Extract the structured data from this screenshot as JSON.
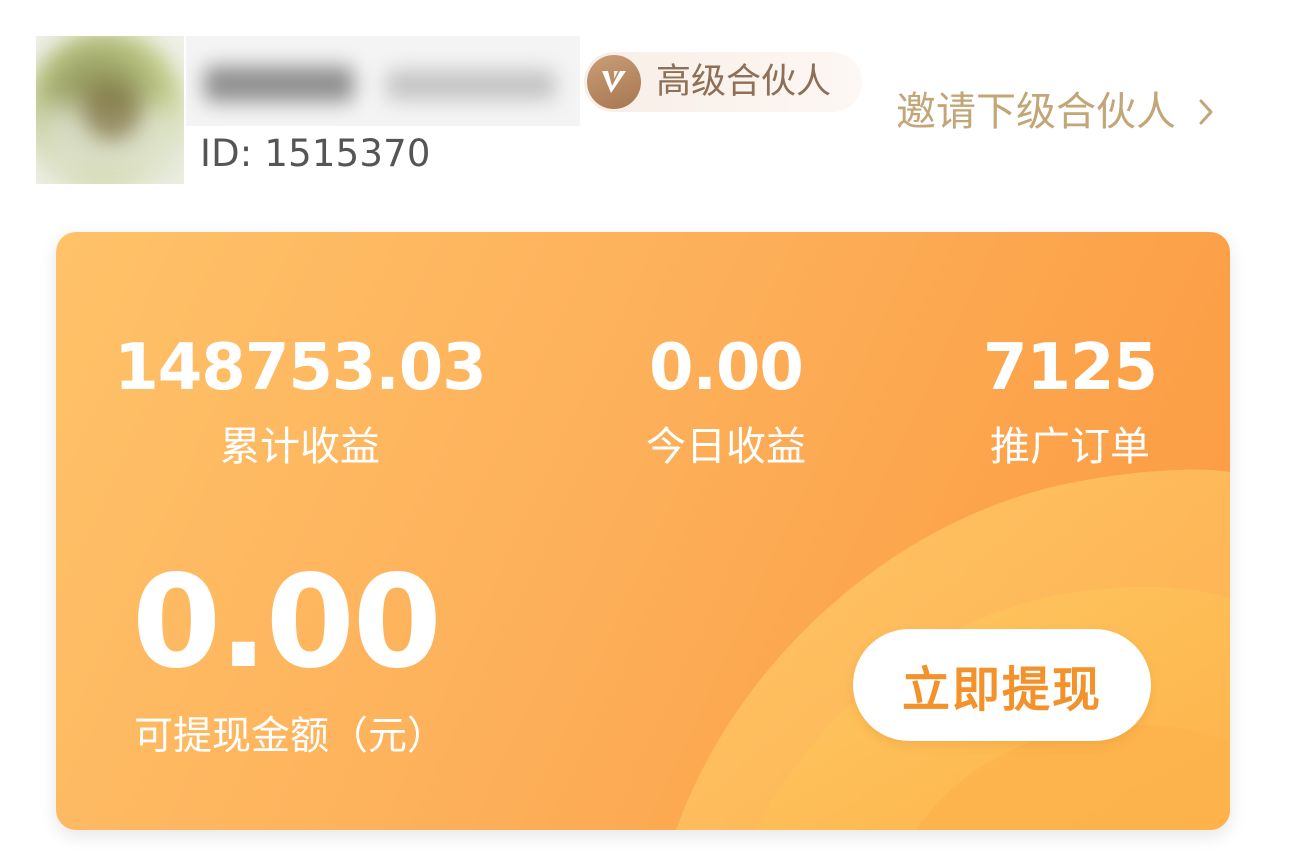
{
  "header": {
    "user_id_text": "ID: 1515370",
    "level_badge": {
      "icon": "v-level-icon",
      "label": "高级合伙人",
      "colors": {
        "icon_bg": "#b5865f",
        "text": "#8e6f57",
        "badge_bg": "#faf0ea"
      }
    },
    "invite_link": {
      "label": "邀请下级合伙人",
      "icon": "chevron-right-icon",
      "color": "#c3a677"
    }
  },
  "earnings_card": {
    "colors": {
      "gradient_start": "#ffc268",
      "gradient_end": "#fb9a41",
      "text": "#ffffff"
    },
    "stats": [
      {
        "value": "148753.03",
        "label": "累计收益"
      },
      {
        "value": "0.00",
        "label": "今日收益"
      },
      {
        "value": "7125",
        "label": "推广订单"
      }
    ],
    "withdrawable": {
      "amount": "0.00",
      "label": "可提现金额（元）"
    },
    "withdraw_button": {
      "label": "立即提现",
      "color": "#f3912a"
    }
  }
}
